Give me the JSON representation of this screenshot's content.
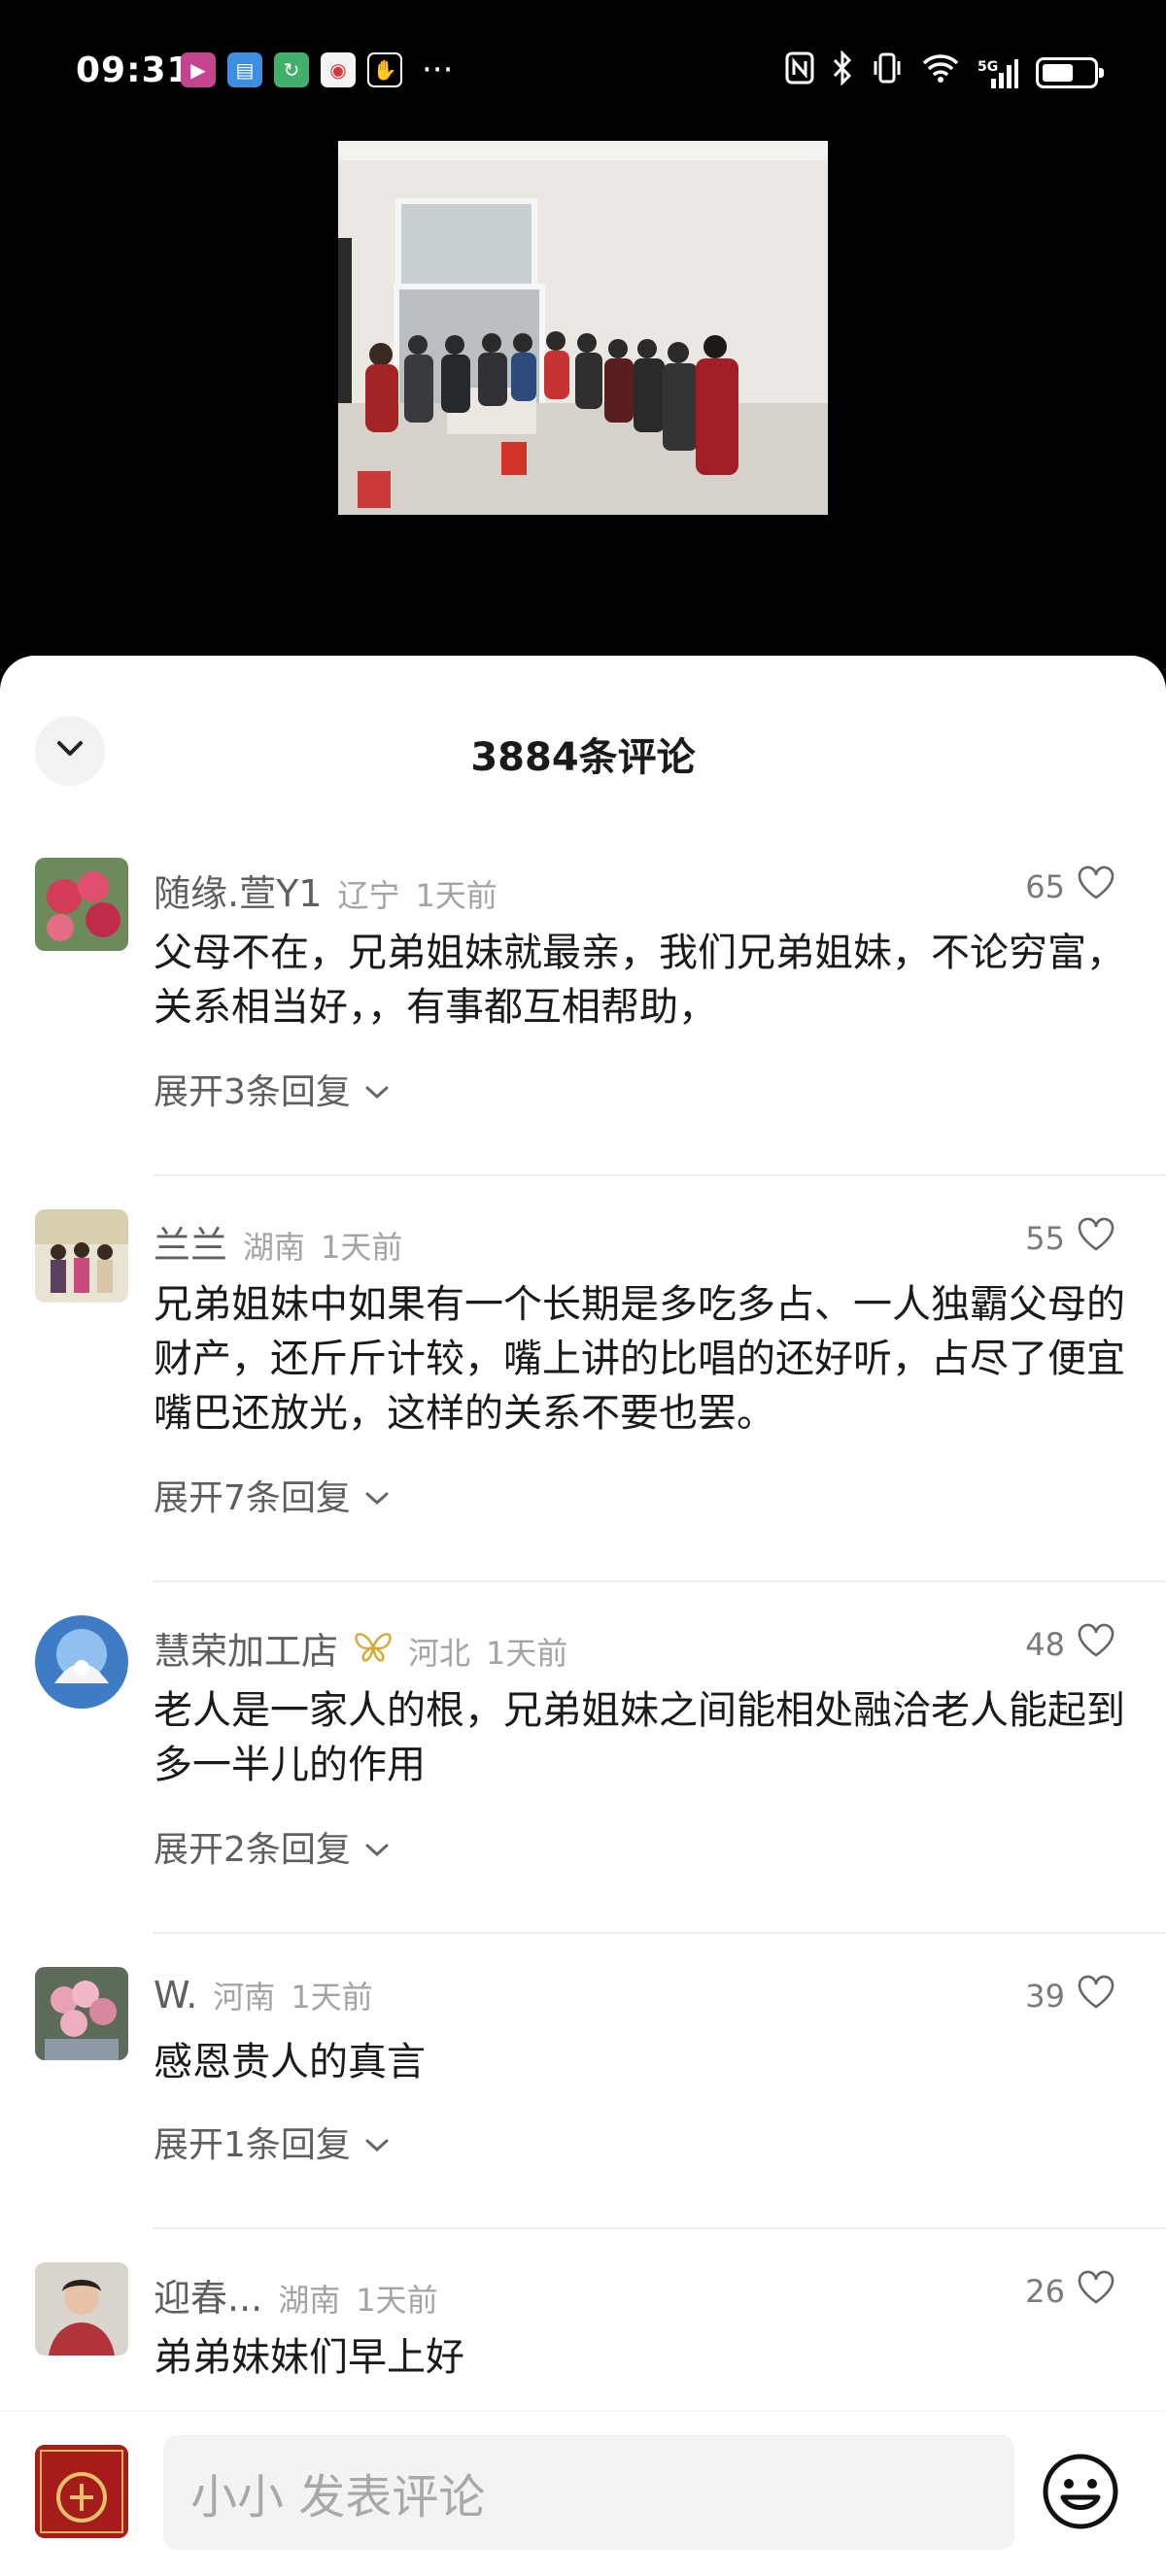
{
  "status_bar": {
    "time": "09:31",
    "more": "···",
    "network": "5G"
  },
  "sheet": {
    "title": "3884条评论"
  },
  "comments": [
    {
      "user": "随缘.萱Y1",
      "location": "辽宁",
      "time": "1天前",
      "likes": "65",
      "text": "父母不在，兄弟姐妹就最亲，我们兄弟姐妹，不论穷富，关系相当好，，有事都互相帮助，",
      "replies": "展开3条回复"
    },
    {
      "user": "兰兰",
      "location": "湖南",
      "time": "1天前",
      "likes": "55",
      "text": "兄弟姐妹中如果有一个长期是多吃多占、一人独霸父母的财产，还斤斤计较，嘴上讲的比唱的还好听，占尽了便宜嘴巴还放光，这样的关系不要也罢。",
      "replies": "展开7条回复"
    },
    {
      "user": "慧荣加工店",
      "location": "河北",
      "time": "1天前",
      "likes": "48",
      "text": "老人是一家人的根，兄弟姐妹之间能相处融洽老人能起到多一半儿的作用",
      "replies": "展开2条回复"
    },
    {
      "user": "W.",
      "location": "河南",
      "time": "1天前",
      "likes": "39",
      "text": "感恩贵人的真言",
      "replies": "展开1条回复"
    },
    {
      "user": "迎春...",
      "location": "湖南",
      "time": "1天前",
      "likes": "26",
      "text": "弟弟妹妹们早上好",
      "replies": ""
    }
  ],
  "bottom_bar": {
    "input_placeholder": "小小 发表评论"
  },
  "icons": {
    "collapse": "chevron-down-icon",
    "like": "heart-outline-icon",
    "expand": "chevron-down-icon",
    "emoji": "smiley-icon"
  },
  "colors": {
    "badge": "#d7a733",
    "text_primary": "#1a1a1a",
    "text_secondary": "#5f5f5f",
    "text_meta": "#a3a3a3"
  }
}
